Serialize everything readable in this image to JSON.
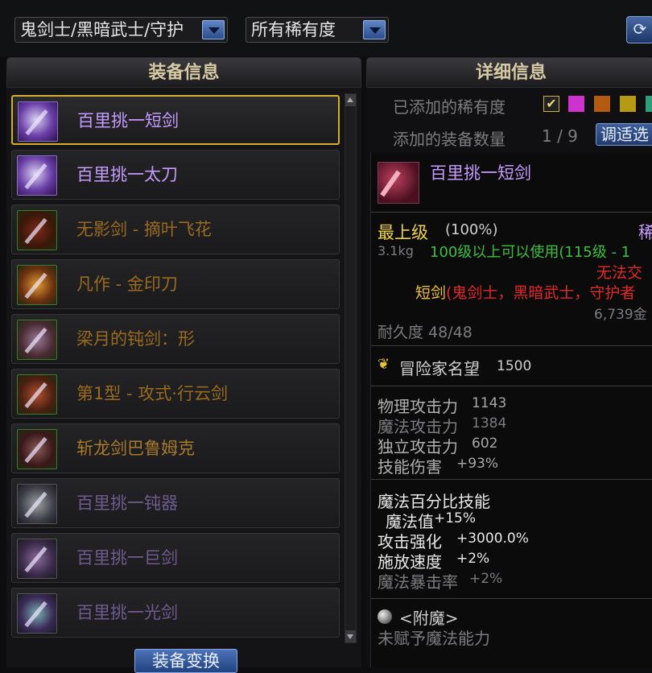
{
  "filters": {
    "job_select": "鬼剑士/黑暗武士/守护",
    "rarity_select": "所有稀有度"
  },
  "left_panel": {
    "title": "装备信息",
    "items": [
      {
        "name": "百里挑一短剑",
        "color": "#c59bff",
        "selected": true
      },
      {
        "name": "百里挑一太刀",
        "color": "#c59bff",
        "selected": false
      },
      {
        "name": "无影剑 - 摘叶飞花",
        "color": "#9a6a1f",
        "selected": false
      },
      {
        "name": "凡作 - 金印刀",
        "color": "#9a6a1f",
        "selected": false
      },
      {
        "name": "梁月的钝剑：形",
        "color": "#9a6a1f",
        "selected": false
      },
      {
        "name": "第1型 - 攻式·行云剑",
        "color": "#9a6a1f",
        "selected": false
      },
      {
        "name": "斩龙剑巴鲁姆克",
        "color": "#a87a2a",
        "selected": false
      },
      {
        "name": "百里挑一钝器",
        "color": "#6f5b8f",
        "selected": false
      },
      {
        "name": "百里挑一巨剑",
        "color": "#6f5b8f",
        "selected": false
      },
      {
        "name": "百里挑一光剑",
        "color": "#6f5b8f",
        "selected": false
      }
    ],
    "bottom_button": "装备变换"
  },
  "right_panel": {
    "title": "详细信息",
    "added_rarity_label": "已添加的稀有度",
    "rarity_swatches": [
      "#cf33cf",
      "#b55a12",
      "#b59a14",
      "#2aa07a"
    ],
    "added_count_label": "添加的装备数量",
    "added_count_value": "1 / 9",
    "filter_button": "调适选",
    "item_title": "百里挑一短剑",
    "grade_label": "最上级",
    "grade_percent": "(100%)",
    "rarity_fragment": "稀",
    "weight": "3.1kg",
    "level_req": "100级以上可以使用(115级 - 1",
    "trade_note": "无法交",
    "type_line": "短剑(鬼剑士，黑暗武士，守护者",
    "price": "6,739金",
    "durability": "耐久度 48/48",
    "fame_label": "冒险家名望",
    "fame_value": "1500",
    "stats": [
      {
        "label": "物理攻击力",
        "value": "1143",
        "muted": false
      },
      {
        "label": "魔法攻击力",
        "value": "1384",
        "muted": true
      },
      {
        "label": "独立攻击力",
        "value": "602",
        "muted": false
      },
      {
        "label": "技能伤害",
        "value": "+93%",
        "muted": false
      }
    ],
    "magic_section_title": "魔法百分比技能",
    "magic_lines": [
      {
        "label": "魔法值",
        "value": "+15%",
        "muted": false
      },
      {
        "label": "攻击强化",
        "value": "+3000.0%",
        "muted": false
      },
      {
        "label": "施放速度",
        "value": "+2%",
        "muted": false
      },
      {
        "label": "魔法暴击率",
        "value": "+2%",
        "muted": true
      }
    ],
    "enchant_title": "<附魔>",
    "enchant_desc": "未赋予魔法能力"
  }
}
